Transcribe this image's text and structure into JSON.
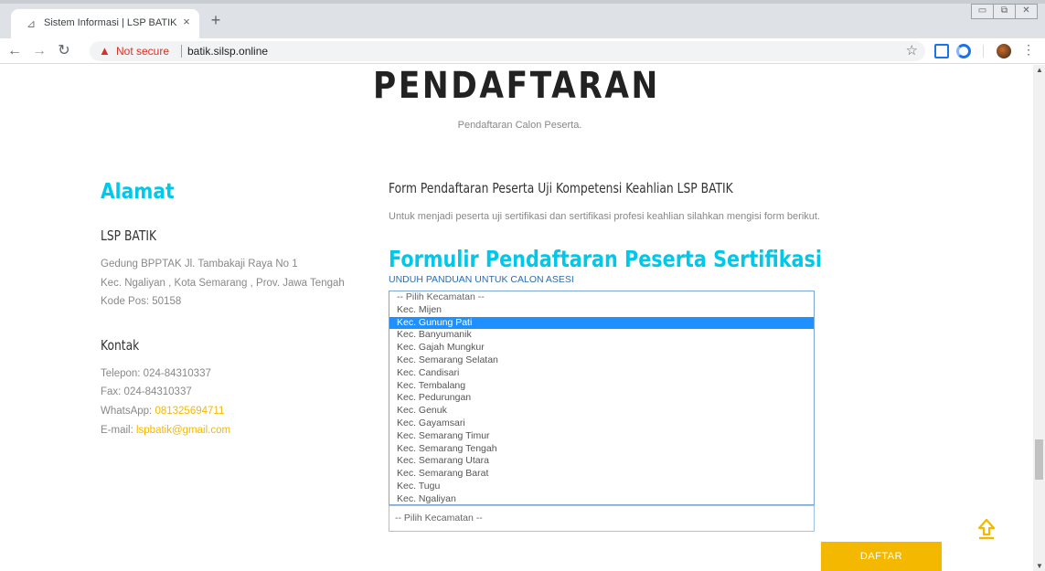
{
  "browser": {
    "tab_title": "Sistem Informasi | LSP BATIK",
    "tab_close": "×",
    "new_tab": "+",
    "security_label": "Not secure",
    "url": "batik.silsp.online"
  },
  "page": {
    "heading": "PENDAFTARAN",
    "subheading": "Pendaftaran Calon Peserta."
  },
  "sidebar": {
    "alamat_title": "Alamat",
    "org_name": "LSP BATIK",
    "address_lines": [
      "Gedung BPPTAK Jl. Tambakaji Raya No 1",
      "Kec. Ngaliyan , Kota Semarang , Prov. Jawa Tengah",
      "Kode Pos: 50158"
    ],
    "kontak_title": "Kontak",
    "telepon": "Telepon: 024-84310337",
    "fax": "Fax: 024-84310337",
    "whatsapp_label": "WhatsApp: ",
    "whatsapp_number": "081325694711",
    "email_label": "E-mail: ",
    "email": "lspbatik@gmail.com"
  },
  "form": {
    "title": "Form Pendaftaran Peserta Uji Kompetensi Keahlian LSP BATIK",
    "description": "Untuk menjadi peserta uji sertifikasi dan sertifikasi profesi keahlian silahkan mengisi form berikut.",
    "formulir_title": "Formulir Pendaftaran Peserta Sertifikasi",
    "unduh_link": "UNDUH PANDUAN UNTUK CALON ASESI",
    "kecamatan_select_value": "-- Pilih Kecamatan --",
    "submit_label": "DAFTAR"
  },
  "dropdown": {
    "placeholder": "-- Pilih Kecamatan --",
    "selected": "Kec. Gunung Pati",
    "options": [
      "Kec. Mijen",
      "Kec. Gunung Pati",
      "Kec. Banyumanik",
      "Kec. Gajah Mungkur",
      "Kec. Semarang Selatan",
      "Kec. Candisari",
      "Kec. Tembalang",
      "Kec. Pedurungan",
      "Kec. Genuk",
      "Kec. Gayamsari",
      "Kec. Semarang Timur",
      "Kec. Semarang Tengah",
      "Kec. Semarang Utara",
      "Kec. Semarang Barat",
      "Kec. Tugu",
      "Kec. Ngaliyan"
    ]
  },
  "colors": {
    "accent_cyan": "#00c8ea",
    "accent_yellow": "#f5b800",
    "selected_blue": "#1e90ff"
  }
}
